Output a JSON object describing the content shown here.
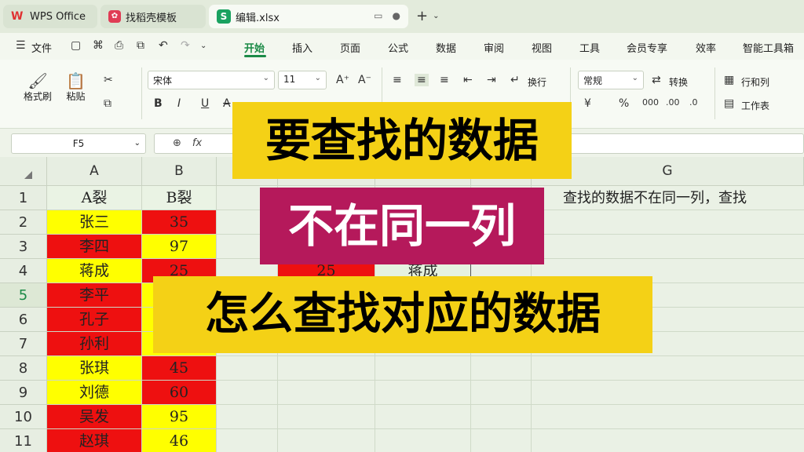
{
  "tabs": [
    {
      "label": "WPS Office",
      "icon": "wps-logo-icon"
    },
    {
      "label": "找稻壳模板",
      "icon": "docer-icon"
    },
    {
      "label": "编辑.xlsx",
      "icon": "spreadsheet-s-icon"
    }
  ],
  "menu": {
    "file": "文件",
    "items": [
      "开始",
      "插入",
      "页面",
      "公式",
      "数据",
      "审阅",
      "视图",
      "工具",
      "会员专享",
      "效率",
      "智能工具箱"
    ],
    "active": "开始"
  },
  "ribbon": {
    "format_painter": "格式刷",
    "paste": "粘贴",
    "font_name": "宋体",
    "font_size": "11",
    "wrap": "换行",
    "number_format": "常规",
    "convert": "转换",
    "row_col": "行和列",
    "worksheet": "工作表"
  },
  "formula_bar": {
    "name_box": "F5",
    "fx": "fx"
  },
  "grid": {
    "columns": [
      "A",
      "B",
      "",
      "",
      "",
      "",
      "G"
    ],
    "rows": [
      "1",
      "2",
      "3",
      "4",
      "5",
      "6",
      "7",
      "8",
      "9",
      "10",
      "11"
    ],
    "header": {
      "a": "A裂",
      "b": "B裂"
    },
    "data": [
      {
        "name": "张三",
        "value": "35"
      },
      {
        "name": "李四",
        "value": "97"
      },
      {
        "name": "蒋成",
        "value": "25"
      },
      {
        "name": "李平",
        "value": ""
      },
      {
        "name": "孔子",
        "value": ""
      },
      {
        "name": "孙利",
        "value": ""
      },
      {
        "name": "张琪",
        "value": "45"
      },
      {
        "name": "刘德",
        "value": "60"
      },
      {
        "name": "吴发",
        "value": "95"
      },
      {
        "name": "赵琪",
        "value": "46"
      }
    ],
    "lookup_value": "25",
    "lookup_result": "蒋成",
    "note": "查找的数据不在同一列，查找"
  },
  "captions": {
    "line1": "要查找的数据",
    "line2": "不在同一列",
    "line3": "怎么查找对应的数据"
  },
  "colors": {
    "accent": "#1a8a46",
    "red_cell": "#ee1010",
    "yellow_cell": "#ffff00",
    "caption_yellow": "#f4d116",
    "caption_magenta": "#b5195b"
  }
}
